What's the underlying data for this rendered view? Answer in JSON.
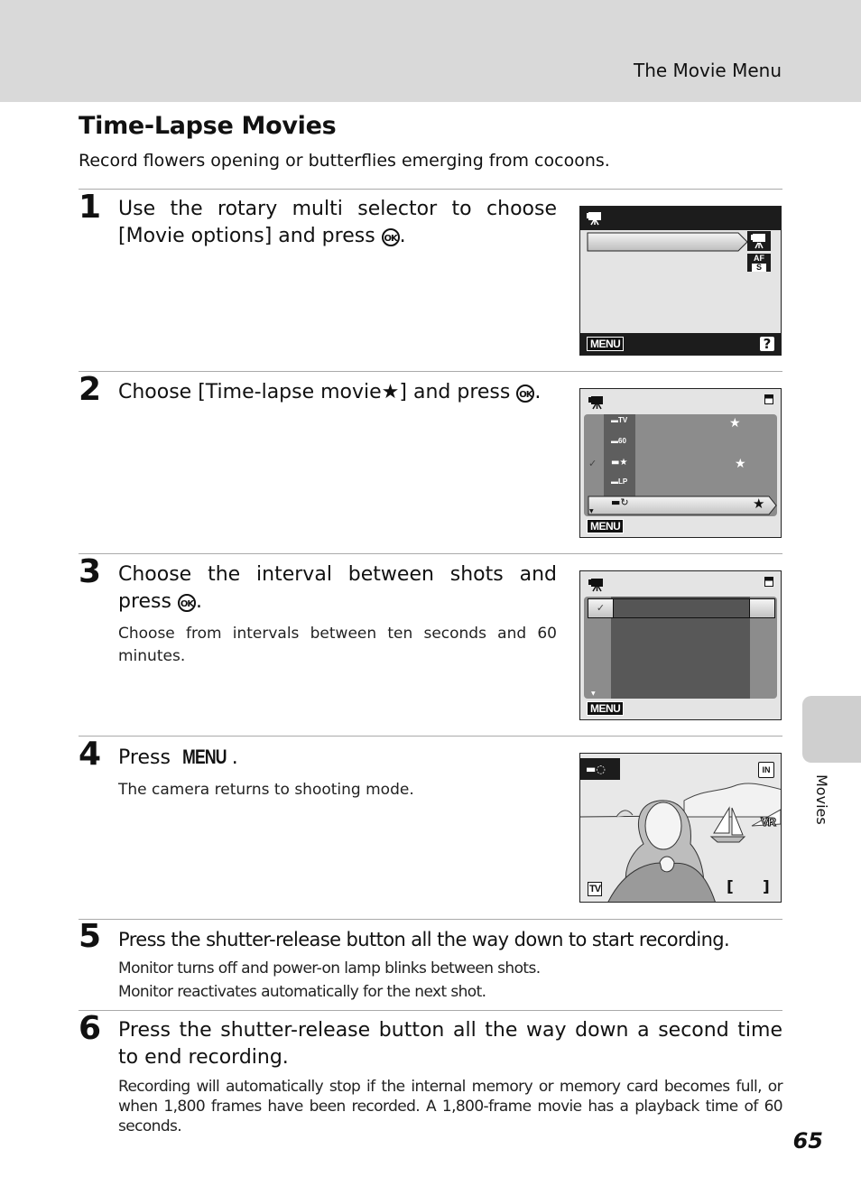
{
  "header": {
    "section": "The Movie Menu"
  },
  "title": "Time-Lapse Movies",
  "intro": "Record flowers opening or butterflies emerging from cocoons.",
  "steps": [
    {
      "num": "1",
      "text_a": "Use the rotary multi selector to choose [Movie options] and press",
      "ok": "OK",
      "end": "."
    },
    {
      "num": "2",
      "text_a": "Choose [Time-lapse movie★] and press",
      "ok": "OK",
      "end": "."
    },
    {
      "num": "3",
      "text_a": "Choose the interval between shots and press",
      "ok": "OK",
      "end": ".",
      "sub": "Choose from intervals between ten seconds and 60 minutes."
    },
    {
      "num": "4",
      "text_a": "Press",
      "menu": "MENU",
      "end": ".",
      "sub": "The camera returns to shooting mode."
    },
    {
      "num": "5",
      "text_a": "Press the shutter-release button all the way down to start recording.",
      "sub1": "Monitor turns off and power-on lamp blinks between shots.",
      "sub2": "Monitor reactivates automatically for the next shot."
    },
    {
      "num": "6",
      "text_a": "Press the shutter-release button all the way down a second time to end recording.",
      "sub": "Recording will automatically stop if the internal memory or memory card becomes full, or when 1,800 frames have been recorded. A 1,800-frame movie has a playback time of 60 seconds."
    }
  ],
  "screens": {
    "menu_label": "MENU",
    "help_label": "?",
    "af_label": "AF",
    "s_label": "S",
    "s2_items": [
      {
        "sub": "TV",
        "star": "★",
        "checked": false
      },
      {
        "sub": "60",
        "star": "",
        "checked": false
      },
      {
        "sub": "",
        "star": "★",
        "checked": true
      },
      {
        "sub": "LP",
        "star": "",
        "checked": false
      },
      {
        "sub": "↻",
        "star": "★",
        "checked": false,
        "selected": true
      }
    ],
    "check": "✓",
    "s4_in": "IN",
    "s4_vr": "VR",
    "s4_tv": "TV",
    "s4_bracket_l": "[",
    "s4_bracket_r": "]"
  },
  "side_tab": "Movies",
  "page_number": "65"
}
